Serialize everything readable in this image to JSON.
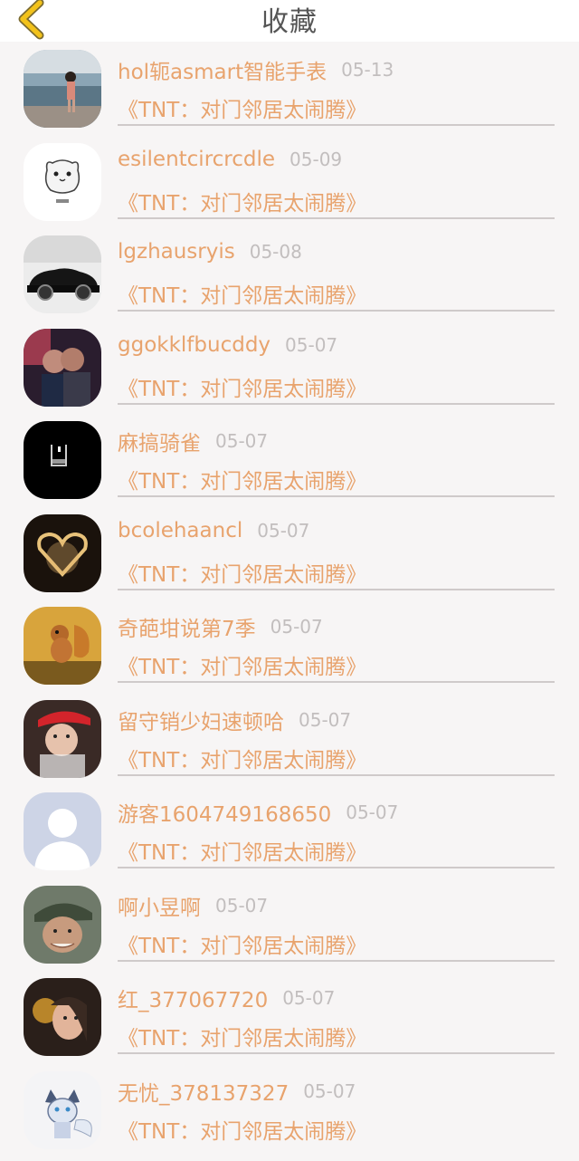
{
  "header": {
    "title": "收藏",
    "back_icon": "chevron-left-icon",
    "accent_color": "#f2c21b"
  },
  "colors": {
    "name": "#e8a36d",
    "date": "#c2bebe",
    "divider": "#cfcaca"
  },
  "items": [
    {
      "name": "hol轭asmart智能手表",
      "date": "05-13",
      "movie": "《TNT：对门邻居太闹腾》",
      "avatar": "avatar-beach-photo"
    },
    {
      "name": "esilentcircrcdle",
      "date": "05-09",
      "movie": "《TNT：对门邻居太闹腾》",
      "avatar": "avatar-cartoon-cat"
    },
    {
      "name": "lgzhausryis",
      "date": "05-08",
      "movie": "《TNT：对门邻居太闹腾》",
      "avatar": "avatar-sports-car"
    },
    {
      "name": "ggokklfbucddy",
      "date": "05-07",
      "movie": "《TNT：对门邻居太闹腾》",
      "avatar": "avatar-couple-photo"
    },
    {
      "name": "麻搞骑雀",
      "date": "05-07",
      "movie": "《TNT：对门邻居太闹腾》",
      "avatar": "avatar-game-black"
    },
    {
      "name": "bcolehaancl",
      "date": "05-07",
      "movie": "《TNT：对门邻居太闹腾》",
      "avatar": "avatar-heart-light"
    },
    {
      "name": "奇葩坩说第7季",
      "date": "05-07",
      "movie": "《TNT：对门邻居太闹腾》",
      "avatar": "avatar-squirrel"
    },
    {
      "name": "留守销少妇速顿哈",
      "date": "05-07",
      "movie": "《TNT：对门邻居太闹腾》",
      "avatar": "avatar-red-cap-girl"
    },
    {
      "name": "游客1604749168650",
      "date": "05-07",
      "movie": "《TNT：对门邻居太闹腾》",
      "avatar": "avatar-default-person"
    },
    {
      "name": "啊小昱啊",
      "date": "05-07",
      "movie": "《TNT：对门邻居太闹腾》",
      "avatar": "avatar-soldier"
    },
    {
      "name": "红_377067720",
      "date": "05-07",
      "movie": "《TNT：对门邻居太闹腾》",
      "avatar": "avatar-girl-flower"
    },
    {
      "name": "无忧_378137327",
      "date": "05-07",
      "movie": "《TNT：对门邻居太闹腾》",
      "avatar": "avatar-fox-character"
    }
  ]
}
